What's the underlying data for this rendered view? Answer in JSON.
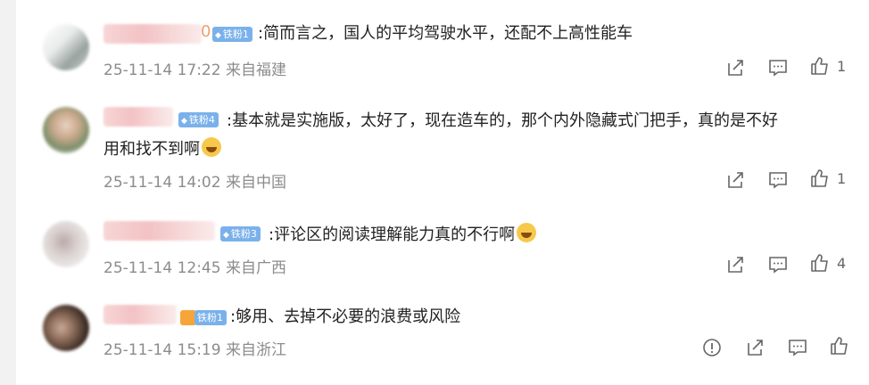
{
  "comments": [
    {
      "badge": "铁粉1",
      "name_tail": "0",
      "text": ":简而言之，国人的平均驾驶水平，还配不上高性能车",
      "time": "25-11-14 17:22",
      "location": "来自福建",
      "likes": "1"
    },
    {
      "badge": "铁粉4",
      "text_line1": ":基本就是实施版，太好了，现在造车的，那个内外隐藏式门把手，真的是不好",
      "text_line2": "用和找不到啊",
      "time": "25-11-14 14:02",
      "location": "来自中国",
      "likes": "1"
    },
    {
      "badge": "铁粉3",
      "text": ":评论区的阅读理解能力真的不行啊",
      "time": "25-11-14 12:45",
      "location": "来自广西",
      "likes": "4"
    },
    {
      "badge": "铁粉1",
      "text": ":够用、去掉不必要的浪费或风险",
      "time": "25-11-14 15:19",
      "location": "来自浙江"
    }
  ],
  "colors": {
    "badge_blue": "#7ab1ea",
    "text": "#222222",
    "meta": "#8c8c8c",
    "icon": "#666666"
  },
  "icons": [
    "share-icon",
    "comment-icon",
    "like-icon",
    "report-icon"
  ]
}
